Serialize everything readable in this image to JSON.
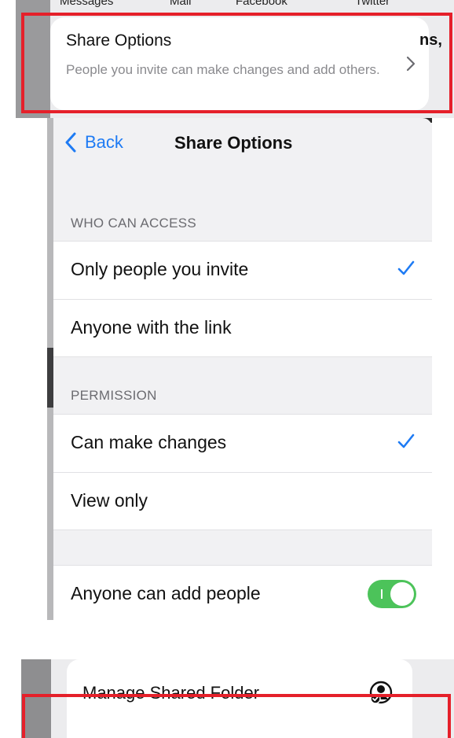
{
  "top_panel": {
    "share_targets": [
      "Messages",
      "Mail",
      "Facebook",
      "Twitter"
    ],
    "share_options_title": "Share Options",
    "share_options_subtitle": "People you invite can make changes and add others.",
    "partial_text": "ns,"
  },
  "nav": {
    "back_label": "Back",
    "title": "Share Options"
  },
  "who_can_access": {
    "header": "WHO CAN ACCESS",
    "options": [
      {
        "label": "Only people you invite",
        "selected": true
      },
      {
        "label": "Anyone with the link",
        "selected": false
      }
    ]
  },
  "permission": {
    "header": "PERMISSION",
    "options": [
      {
        "label": "Can make changes",
        "selected": true
      },
      {
        "label": "View only",
        "selected": false
      }
    ]
  },
  "add_people": {
    "label": "Anyone can add people",
    "enabled": true
  },
  "manage": {
    "label": "Manage Shared Folder",
    "icon": "shared-folder-person-icon"
  },
  "colors": {
    "accent": "#1e7bf4",
    "toggle_on": "#4cc35a",
    "highlight": "#e5202a"
  }
}
